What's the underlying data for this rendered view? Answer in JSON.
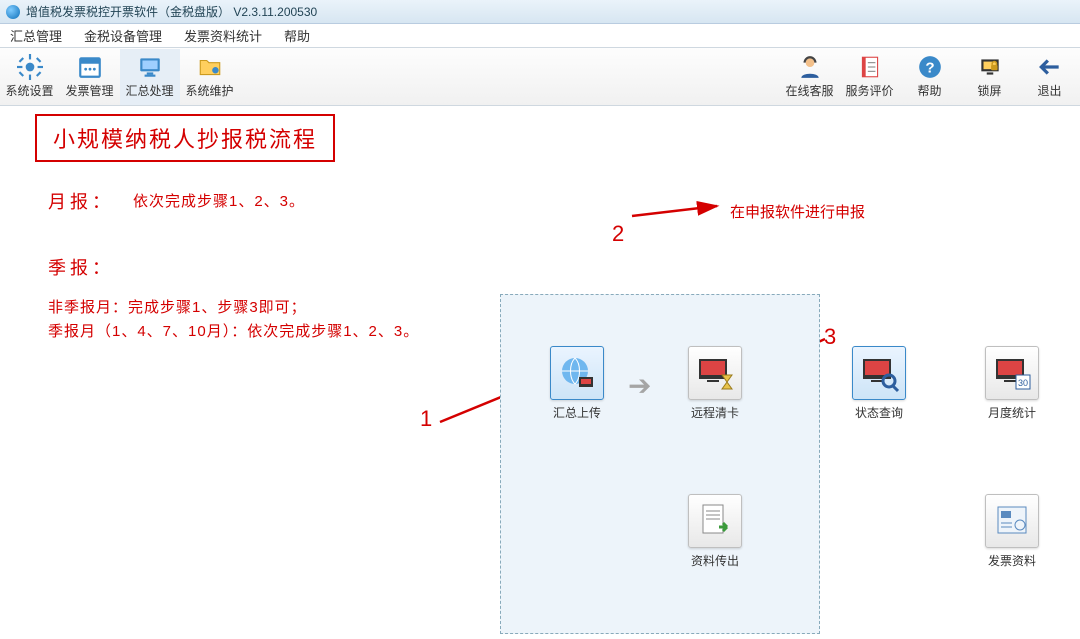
{
  "titlebar": {
    "title": "增值税发票税控开票软件（金税盘版） V2.3.11.200530"
  },
  "menubar": {
    "items": [
      "汇总管理",
      "金税设备管理",
      "发票资料统计",
      "帮助"
    ]
  },
  "toolbar_left": [
    {
      "label": "系统设置",
      "icon": "gear"
    },
    {
      "label": "发票管理",
      "icon": "calendar"
    },
    {
      "label": "汇总处理",
      "icon": "monitor",
      "active": true
    },
    {
      "label": "系统维护",
      "icon": "folder"
    }
  ],
  "toolbar_right": [
    {
      "label": "在线客服",
      "icon": "agent"
    },
    {
      "label": "服务评价",
      "icon": "book"
    },
    {
      "label": "帮助",
      "icon": "help"
    },
    {
      "label": "锁屏",
      "icon": "lock"
    },
    {
      "label": "退出",
      "icon": "exit"
    }
  ],
  "annotations": {
    "title": "小规模纳税人抄报税流程",
    "monthly_label": "月报：",
    "monthly_text": "依次完成步骤1、2、3。",
    "quarter_label": "季报：",
    "quarter_text1": "非季报月：完成步骤1、步骤3即可；",
    "quarter_text2": "季报月（1、4、7、10月）：依次完成步骤1、2、3。",
    "step2_note": "在申报软件进行申报",
    "n1": "1",
    "n2": "2",
    "n3": "3"
  },
  "cards": {
    "upload": "汇总上传",
    "clear": "远程清卡",
    "status": "状态查询",
    "monthstat": "月度统计",
    "export": "资料传出",
    "invoice": "发票资料"
  }
}
